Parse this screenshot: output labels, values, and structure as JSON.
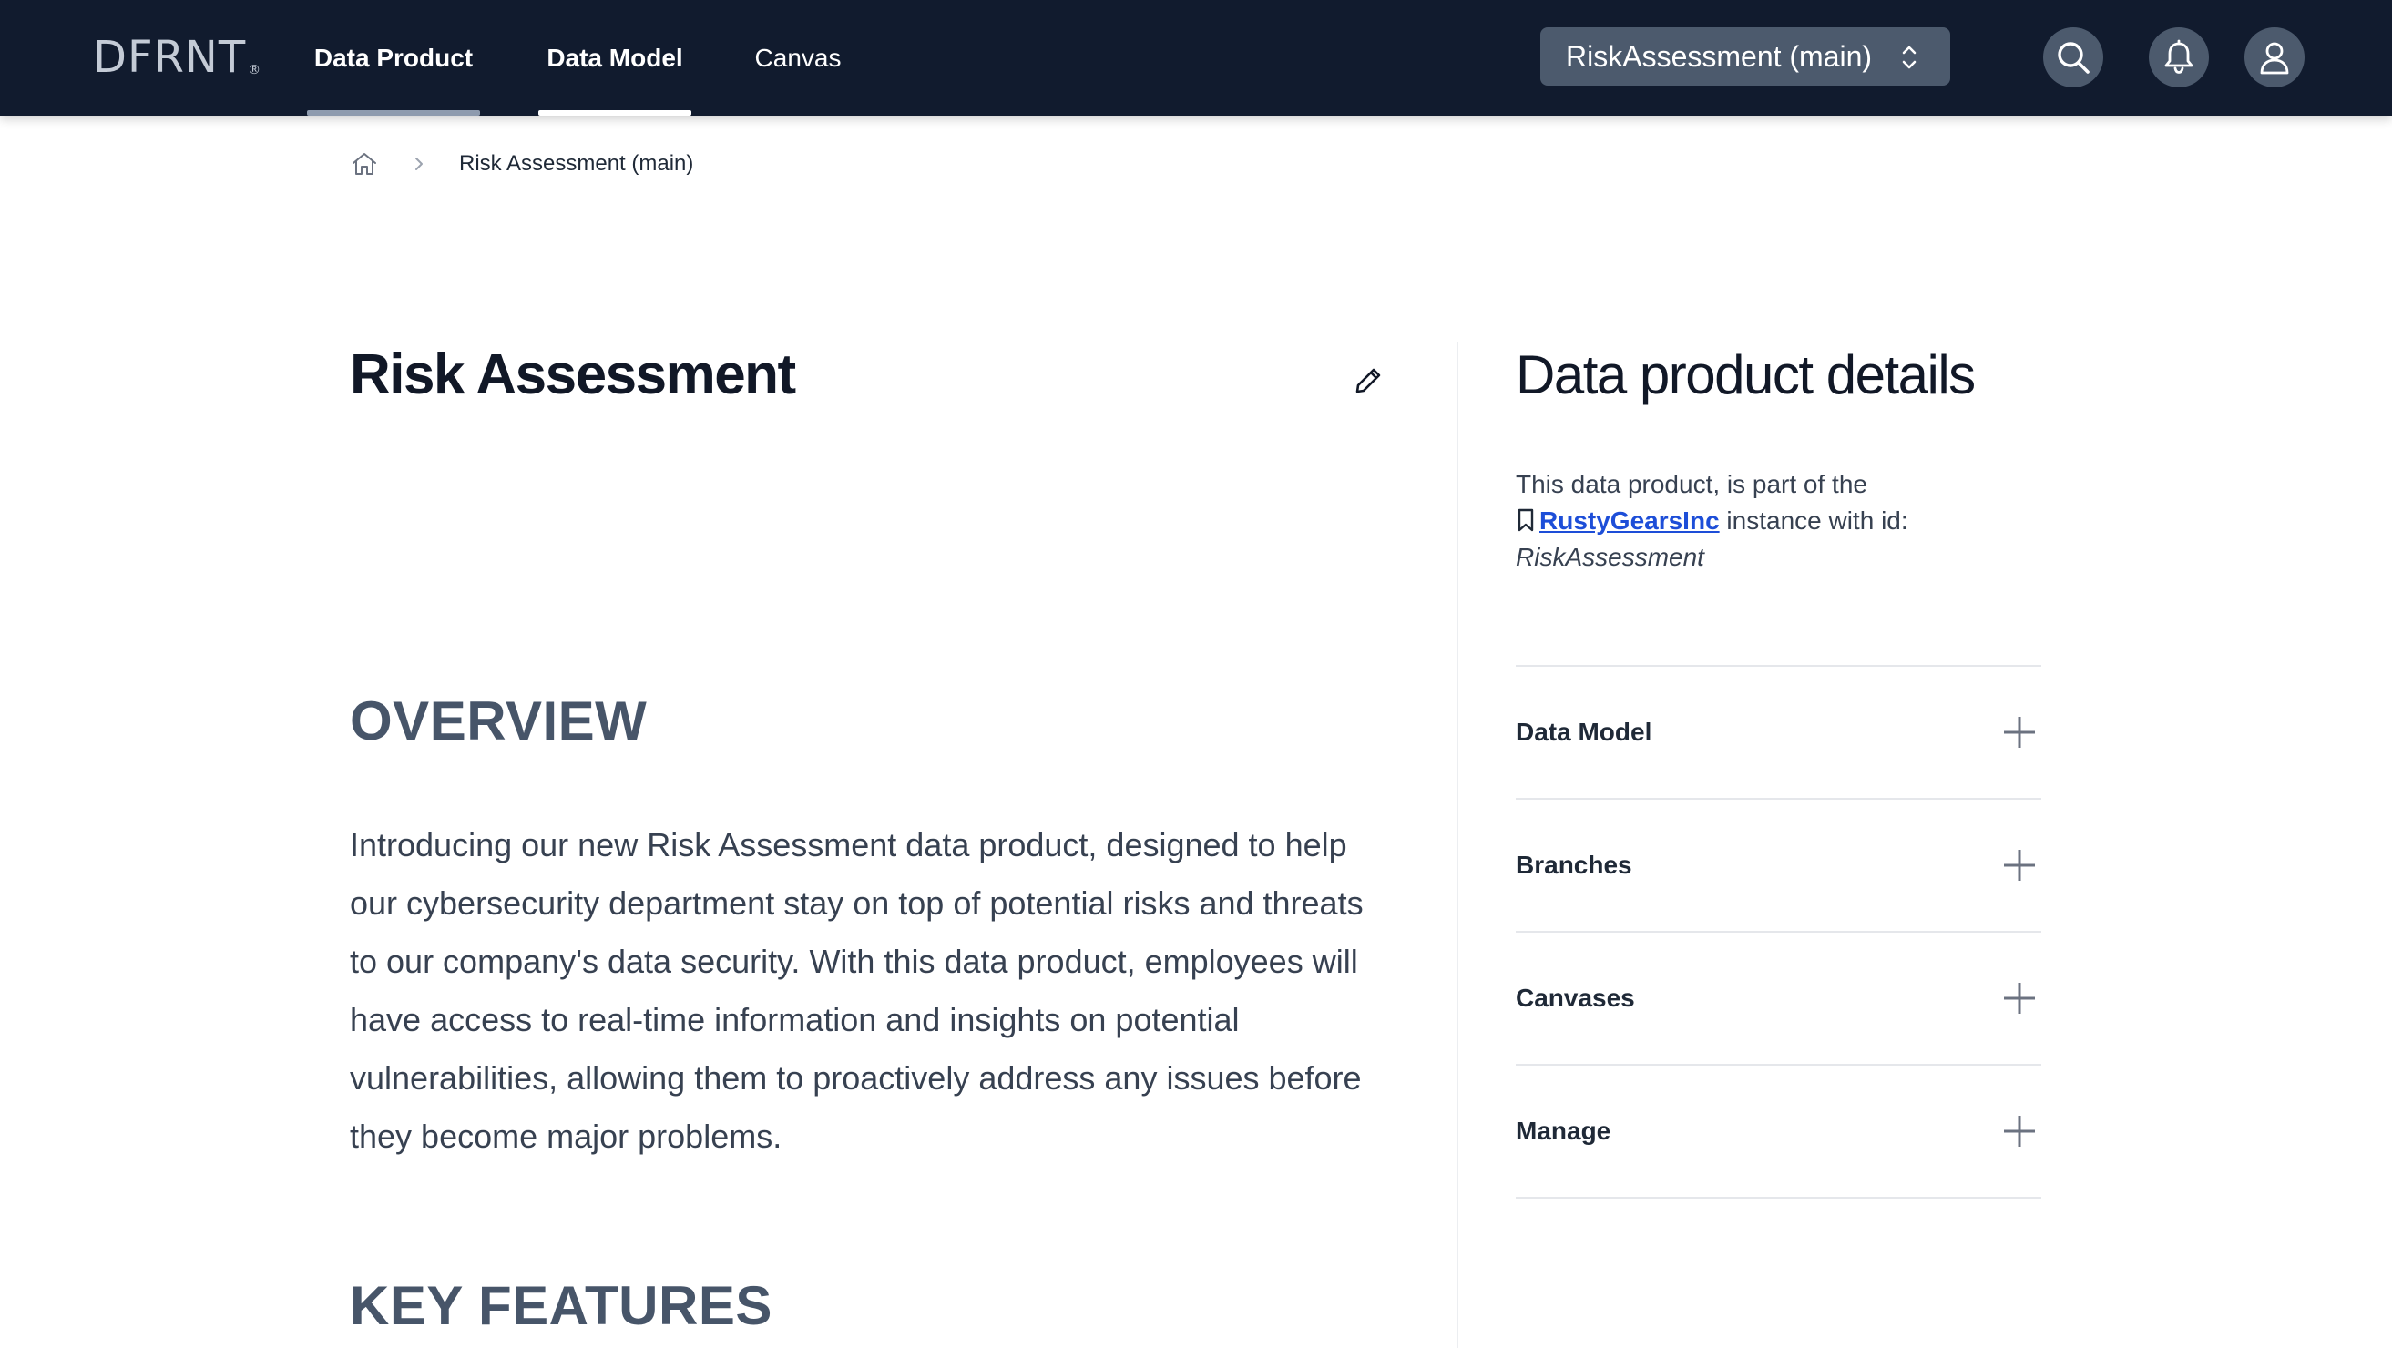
{
  "header": {
    "logo_text": "DFRNT",
    "logo_mark": "®",
    "tabs": [
      {
        "label": "Data Product",
        "active": true
      },
      {
        "label": "Data Model",
        "active": false
      },
      {
        "label": "Canvas",
        "active": false
      }
    ],
    "branch_selector": {
      "value": "RiskAssessment (main)"
    },
    "icons": [
      "search-icon",
      "bell-icon",
      "user-icon"
    ]
  },
  "breadcrumb": {
    "home_icon": "home-icon",
    "current": "Risk Assessment (main)"
  },
  "main": {
    "title": "Risk Assessment",
    "edit_icon": "pencil-icon",
    "overview_heading": "OVERVIEW",
    "overview_text": "Introducing our new Risk Assessment data product, designed to help our cybersecurity department stay on top of potential risks and threats to our company's data security. With this data product, employees will have access to real-time information and insights on potential vulnerabilities, allowing them to proactively address any issues before they become major problems.",
    "key_features_heading": "KEY FEATURES"
  },
  "side_panel": {
    "title": "Data product details",
    "desc_prefix": "This data product, is part of the",
    "instance_name": "RustyGearsInc",
    "desc_middle": "instance with id:",
    "instance_id": "RiskAssessment",
    "sections": [
      {
        "label": "Data Model"
      },
      {
        "label": "Branches"
      },
      {
        "label": "Canvases"
      },
      {
        "label": "Manage"
      }
    ]
  },
  "colors": {
    "navbar": "#111b2e",
    "control": "#4c5a6d",
    "link": "#1d4ed8",
    "heading_muted": "#475569"
  }
}
